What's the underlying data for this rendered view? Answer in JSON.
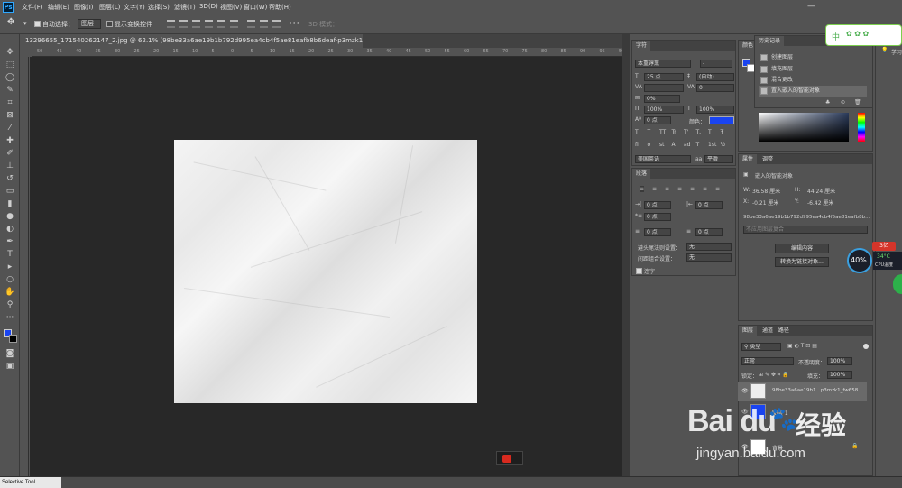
{
  "app": {
    "logo": "Ps"
  },
  "menu": [
    "文件(F)",
    "编辑(E)",
    "图像(I)",
    "图层(L)",
    "文字(Y)",
    "选择(S)",
    "滤镜(T)",
    "3D(D)",
    "视图(V)",
    "窗口(W)",
    "帮助(H)"
  ],
  "window_controls": [
    "—",
    "□",
    "✕"
  ],
  "options": {
    "auto_select_label": "自动选择：",
    "auto_select_value": "图层",
    "show_transform_label": "显示变换控件",
    "threed_mode": "3D 模式：",
    "more": "•••"
  },
  "document": {
    "tab_title": "13296655_171540262147_2.jpg @ 62.1% (98be33a6ae19b1b792d995ea4cb4f5ae81eafb8b6deaf-p3mzk1_fw658, RGB/8#) *",
    "close": "×"
  },
  "ruler_h": [
    "50",
    "45",
    "40",
    "35",
    "30",
    "25",
    "20",
    "15",
    "10",
    "5",
    "0",
    "5",
    "10",
    "15",
    "20",
    "25",
    "30",
    "35",
    "40",
    "45",
    "50",
    "55",
    "60",
    "65",
    "70",
    "75",
    "80",
    "85",
    "90",
    "95",
    "50"
  ],
  "character": {
    "title": "字符",
    "font_family": "本重谆熏",
    "font_style": "-",
    "size": "25 点",
    "leading": "(自动)",
    "kerning": "",
    "tracking": "0",
    "tsume": "0%",
    "vscale": "100%",
    "hscale": "100%",
    "baseline": "0 点",
    "color_label": "颜色：",
    "color_value": "#1a44f0",
    "language": "美国英语",
    "antialias": "平滑",
    "typeface_buttons": [
      "T",
      "T",
      "TT",
      "Tr",
      "T'",
      "T,",
      "T",
      "Ŧ"
    ],
    "opentype_buttons": [
      "fi",
      "σ",
      "st",
      "A",
      "ad",
      "T",
      "1st",
      "½"
    ]
  },
  "paragraph": {
    "title": "段落",
    "indent_left": "0 点",
    "indent_right": "0 点",
    "indent_first": "0 点",
    "space_before": "0 点",
    "space_after": "0 点",
    "kinsoku_label": "避头尾法则设置：",
    "kinsoku_value": "无",
    "mojikumi_label": "间距组合设置：",
    "mojikumi_value": "无",
    "hyphenate_label": "连字"
  },
  "color_panel": {
    "title": "颜色",
    "fg": "#1a44f0",
    "bg": "#ffffff"
  },
  "history": {
    "title": "历史记录",
    "items": [
      "创建图层",
      "填充图层",
      "混合更改",
      "置入嵌入的智能对象"
    ],
    "footer_icons": [
      "♣",
      "⊙",
      "🗑"
    ]
  },
  "properties": {
    "tabs": [
      "属性",
      "调整"
    ],
    "type_label": "嵌入的智能对象",
    "w_label": "W:",
    "w_value": "36.58 厘米",
    "h_label": "H:",
    "h_value": "44.24 厘米",
    "x_label": "X:",
    "x_value": "-0.21 厘米",
    "y_label": "Y:",
    "y_value": "-6.42 厘米",
    "filename": "98be33a6ae19b1b792d995ea4cb4f5ae81eafb8b...",
    "comp_placeholder": "不应用图层复合",
    "edit_button": "编辑内容",
    "convert_button": "转换为链接对象..."
  },
  "layers": {
    "tabs": [
      "图层",
      "通道",
      "路径"
    ],
    "filter_label": "类型",
    "blend_mode": "正常",
    "opacity_label": "不透明度：",
    "opacity_value": "100%",
    "lock_label": "锁定：",
    "fill_label": "填充：",
    "fill_value": "100%",
    "items": [
      {
        "name": "98be33a6ae19b1...p3mzk1_fw658",
        "selected": true
      },
      {
        "name": "图层 1",
        "selected": false
      },
      {
        "name": "背景",
        "selected": false
      }
    ]
  },
  "right_strip": {
    "label": "学习"
  },
  "ime": {
    "text": "中"
  },
  "cpu": {
    "percent": "40%",
    "temp": "34°C",
    "label": "CPU温度",
    "badge": "3亿"
  },
  "status": {
    "text": "Selective Tool"
  },
  "watermark": {
    "brand": "Bai du",
    "cn": "经验",
    "url": "jingyan.baidu.com"
  }
}
